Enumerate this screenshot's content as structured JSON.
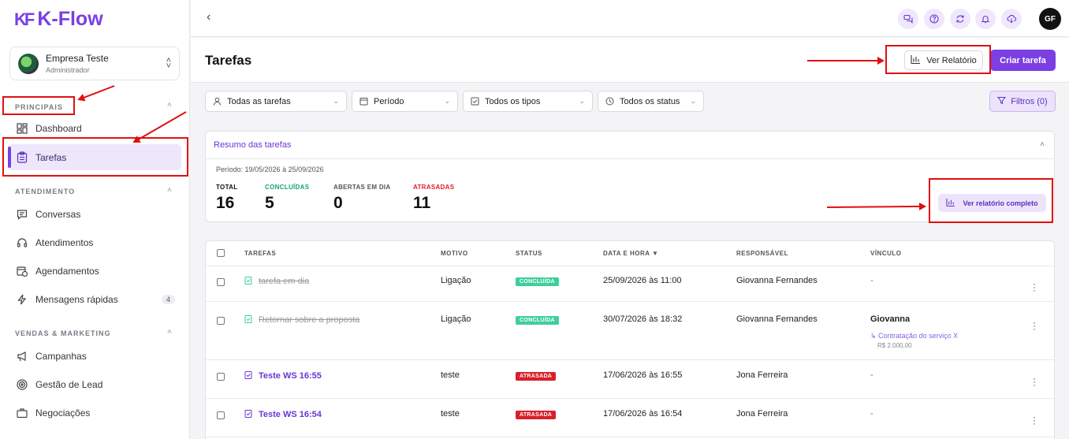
{
  "brand": {
    "logo_mark": "KF",
    "name": "K-Flow",
    "accent": "#7b3fe4"
  },
  "company": {
    "name": "Empresa Teste",
    "role": "Administrador"
  },
  "sidebar": {
    "principais": {
      "title": "PRINCIPAIS",
      "items": [
        {
          "label": "Dashboard",
          "icon": "dashboard-icon"
        },
        {
          "label": "Tarefas",
          "icon": "clipboard-icon"
        }
      ]
    },
    "atendimento": {
      "title": "ATENDIMENTO",
      "items": [
        {
          "label": "Conversas",
          "icon": "chat-icon"
        },
        {
          "label": "Atendimentos",
          "icon": "headset-icon"
        },
        {
          "label": "Agendamentos",
          "icon": "calendar-clock-icon"
        },
        {
          "label": "Mensagens rápidas",
          "icon": "lightning-icon",
          "badge": "4"
        }
      ]
    },
    "vendas": {
      "title": "VENDAS & MARKETING",
      "items": [
        {
          "label": "Campanhas",
          "icon": "megaphone-icon"
        },
        {
          "label": "Gestão de Lead",
          "icon": "target-icon"
        },
        {
          "label": "Negociações",
          "icon": "briefcase-icon"
        }
      ]
    }
  },
  "topbar": {
    "avatar": "GF",
    "back": "‹"
  },
  "page": {
    "title": "Tarefas",
    "report_button": "Ver Relatório",
    "create_button": "Criar tarefa"
  },
  "filters": {
    "tasks": "Todas as tarefas",
    "period": "Período",
    "types": "Todos os tipos",
    "status": "Todos os status",
    "filters_button": "Filtros (0)"
  },
  "summary": {
    "title": "Resumo das tarefas",
    "period": "Período: 19/05/2026 à 25/09/2026",
    "stats": [
      {
        "label": "TOTAL",
        "value": "16",
        "color": "#111111"
      },
      {
        "label": "CONCLUÍDAS",
        "value": "5",
        "color": "#1aa56b"
      },
      {
        "label": "ABERTAS EM DIA",
        "value": "0",
        "color": "#555555"
      },
      {
        "label": "ATRASADAS",
        "value": "11",
        "color": "#e0202e"
      }
    ],
    "full_report_button": "Ver relatório completo"
  },
  "table": {
    "headers": {
      "tasks": "TAREFAS",
      "reason": "MOTIVO",
      "status": "STATUS",
      "datetime": "DATA E HORA ▼",
      "owner": "RESPONSÁVEL",
      "link": "VÍNCULO"
    },
    "rows": [
      {
        "task": "tarefa em dia",
        "reason": "Ligação",
        "status": "CONCLUÍDA",
        "datetime": "25/09/2026 às 11:00",
        "owner": "Giovanna Fernandes",
        "link": "-"
      },
      {
        "task": "Retornar sobre a proposta",
        "reason": "Ligação",
        "status": "CONCLUÍDA",
        "datetime": "30/07/2026 às 18:32",
        "owner": "Giovanna Fernandes",
        "link_name": "Giovanna",
        "link_sub": "↳ Contratação do serviço X",
        "link_value": "R$ 2.000,00"
      },
      {
        "task": "Teste WS 16:55",
        "reason": "teste",
        "status": "ATRASADA",
        "datetime": "17/06/2026 às 16:55",
        "owner": "Jona Ferreira",
        "link": "-"
      },
      {
        "task": "Teste WS 16:54",
        "reason": "teste",
        "status": "ATRASADA",
        "datetime": "17/06/2026 às 16:54",
        "owner": "Jona Ferreira",
        "link": "-"
      }
    ],
    "status_colors": {
      "done": "#3ecf9a",
      "late": "#d8202a"
    }
  }
}
